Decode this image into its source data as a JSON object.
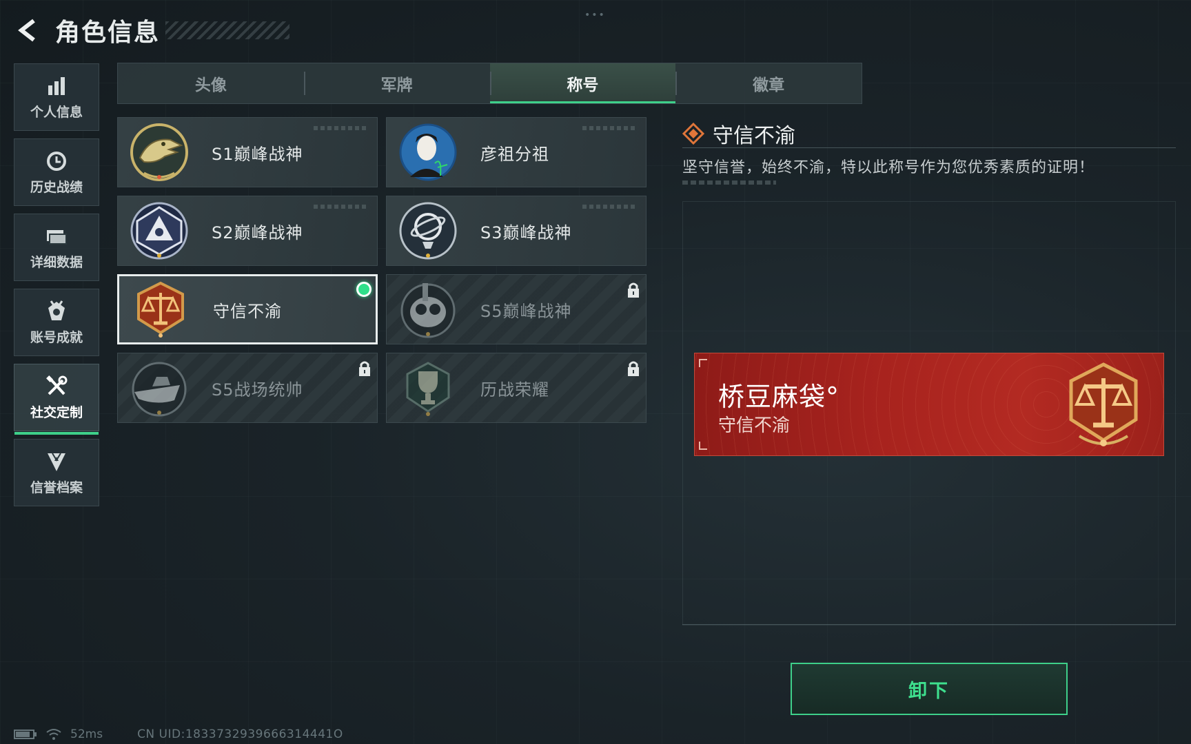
{
  "header": {
    "title": "角色信息"
  },
  "sidebar": {
    "items": [
      {
        "label": "个人信息",
        "icon": "bar-chart-icon"
      },
      {
        "label": "历史战绩",
        "icon": "history-clock-icon"
      },
      {
        "label": "详细数据",
        "icon": "folder-icon"
      },
      {
        "label": "账号成就",
        "icon": "achievement-icon"
      },
      {
        "label": "社交定制",
        "icon": "tools-icon",
        "active": true
      },
      {
        "label": "信誉档案",
        "icon": "credit-shield-icon"
      }
    ]
  },
  "tabs": [
    {
      "label": "头像"
    },
    {
      "label": "军牌"
    },
    {
      "label": "称号",
      "active": true
    },
    {
      "label": "徽章"
    }
  ],
  "titles": [
    {
      "name": "S1巅峰战神",
      "badge": "crocodile-badge-icon",
      "locked": false
    },
    {
      "name": "彦祖分祖",
      "badge": "portrait-badge-icon",
      "locked": false
    },
    {
      "name": "S2巅峰战神",
      "badge": "triangle-emblem-badge-icon",
      "locked": false
    },
    {
      "name": "S3巅峰战神",
      "badge": "globe-badge-icon",
      "locked": false
    },
    {
      "name": "守信不渝",
      "badge": "scales-badge-icon",
      "locked": false,
      "selected": true,
      "equipped": true
    },
    {
      "name": "S5巅峰战神",
      "badge": "gasmask-badge-icon",
      "locked": true
    },
    {
      "name": "S5战场统帅",
      "badge": "boat-badge-icon",
      "locked": true
    },
    {
      "name": "历战荣耀",
      "badge": "trophy-badge-icon",
      "locked": true
    }
  ],
  "detail": {
    "title": "守信不渝",
    "description": "坚守信誉，始终不渝，特以此称号作为您优秀素质的证明！"
  },
  "banner": {
    "player_name": "桥豆麻袋°",
    "title": "守信不渝"
  },
  "actions": {
    "unequip_label": "卸下"
  },
  "footer": {
    "ping": "52ms",
    "uid": "CN UID:1833732939666314441O"
  },
  "colors": {
    "accent_green": "#3ed08a",
    "banner_red": "#a8231e",
    "detail_icon_orange": "#e0763a"
  }
}
